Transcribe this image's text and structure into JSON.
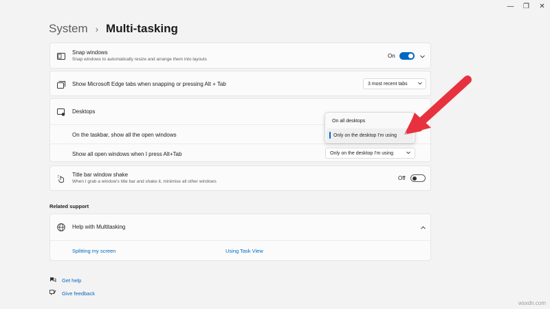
{
  "window": {
    "minimize_glyph": "—",
    "maximize_glyph": "❐",
    "close_glyph": "✕"
  },
  "header": {
    "parent": "System",
    "separator": "›",
    "current": "Multi-tasking"
  },
  "snap": {
    "title": "Snap windows",
    "subtitle": "Snap windows to automatically resize and arrange them into layouts",
    "state_label": "On",
    "toggle_state": "on"
  },
  "edge_tabs": {
    "title": "Show Microsoft Edge tabs when snapping or pressing Alt + Tab",
    "selected": "3 most recent tabs"
  },
  "desktops": {
    "title": "Desktops",
    "taskbar_label": "On the taskbar, show all the open windows",
    "alttab_label": "Show all open windows when I press Alt+Tab",
    "alttab_selected": "Only on the desktop I'm using",
    "flyout_options": [
      "On all desktops",
      "Only on the desktop I'm using"
    ],
    "flyout_selected_index": 1
  },
  "shake": {
    "title": "Title bar window shake",
    "subtitle": "When I grab a window's title bar and shake it, minimise all other windows",
    "state_label": "Off",
    "toggle_state": "off"
  },
  "related": {
    "heading": "Related support",
    "help_title": "Help with Multitasking",
    "links": [
      "Splitting my screen",
      "Using Task View"
    ]
  },
  "footer": {
    "get_help": "Get help",
    "give_feedback": "Give feedback"
  },
  "annotation": {
    "arrow_color": "#e8313f"
  },
  "watermark": "wsxdn.com",
  "colors": {
    "accent": "#0067c0",
    "background": "#f3f3f3",
    "card": "#fbfbfb"
  }
}
